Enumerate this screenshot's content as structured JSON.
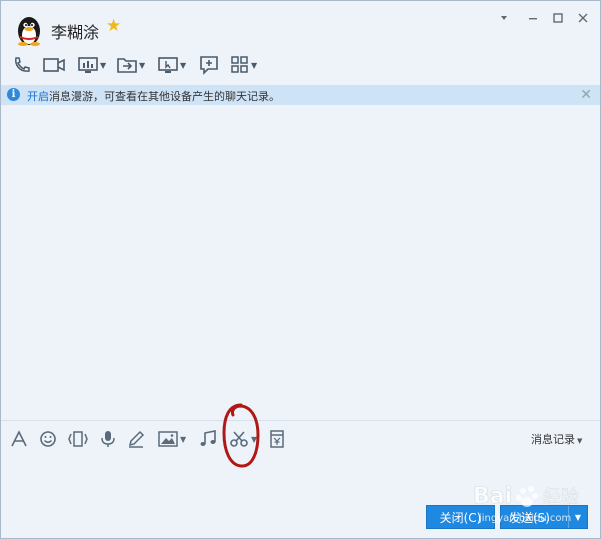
{
  "contact": {
    "name": "李糊涂"
  },
  "window_controls": {
    "menu_icon": "caret-down-icon",
    "minimize_icon": "minimize-icon",
    "maximize_icon": "maximize-icon",
    "close_icon": "close-icon"
  },
  "toolbar": {
    "items": [
      "phone-icon",
      "video-icon",
      "screen-share-icon",
      "file-transfer-icon",
      "remote-desktop-icon",
      "new-chat-icon",
      "apps-icon"
    ]
  },
  "notice": {
    "link": "开启",
    "text": "消息漫游，可查看在其他设备产生的聊天记录。"
  },
  "input_toolbar": {
    "items": [
      "font-icon",
      "emoji-icon",
      "shake-icon",
      "voice-icon",
      "pen-icon",
      "image-icon",
      "music-icon",
      "screenshot-scissors-icon",
      "red-packet-icon"
    ],
    "message_record": "消息记录"
  },
  "buttons": {
    "close": "关闭(C)",
    "send": "发送(S)"
  },
  "colors": {
    "accent": "#1f88e0",
    "notice_bg": "#cfe3f7",
    "annotation": "#b01818"
  },
  "watermark": {
    "text": "Bai du 经验",
    "url": "jingyan.baidu.com"
  }
}
